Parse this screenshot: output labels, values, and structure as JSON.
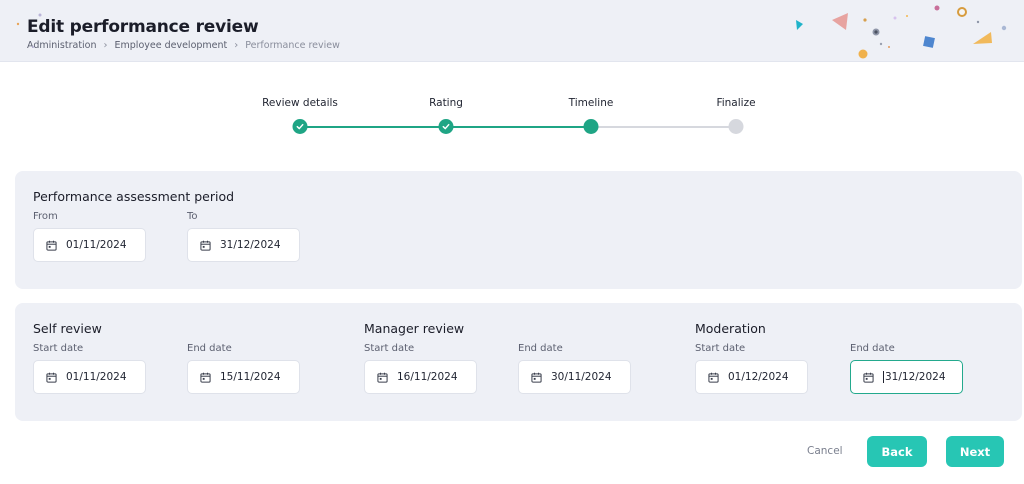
{
  "header": {
    "title": "Edit performance review",
    "breadcrumb": [
      "Administration",
      "Employee development",
      "Performance review"
    ]
  },
  "stepper": {
    "steps": [
      {
        "label": "Review details",
        "state": "completed"
      },
      {
        "label": "Rating",
        "state": "completed"
      },
      {
        "label": "Timeline",
        "state": "current"
      },
      {
        "label": "Finalize",
        "state": "upcoming"
      }
    ],
    "colors": {
      "active": "#1fa585",
      "inactive": "#d6d8de"
    }
  },
  "assessment": {
    "title": "Performance assessment period",
    "from_label": "From",
    "from_value": "01/11/2024",
    "to_label": "To",
    "to_value": "31/12/2024"
  },
  "phases": [
    {
      "title": "Self review",
      "start_label": "Start date",
      "start_value": "01/11/2024",
      "end_label": "End date",
      "end_value": "15/11/2024"
    },
    {
      "title": "Manager review",
      "start_label": "Start date",
      "start_value": "16/11/2024",
      "end_label": "End date",
      "end_value": "30/11/2024"
    },
    {
      "title": "Moderation",
      "start_label": "Start date",
      "start_value": "01/12/2024",
      "end_label": "End date",
      "end_value": "31/12/2024"
    }
  ],
  "actions": {
    "cancel_label": "Cancel",
    "back_label": "Back",
    "next_label": "Next"
  },
  "colors": {
    "accent": "#27c6b4",
    "panel": "#eef0f6"
  }
}
